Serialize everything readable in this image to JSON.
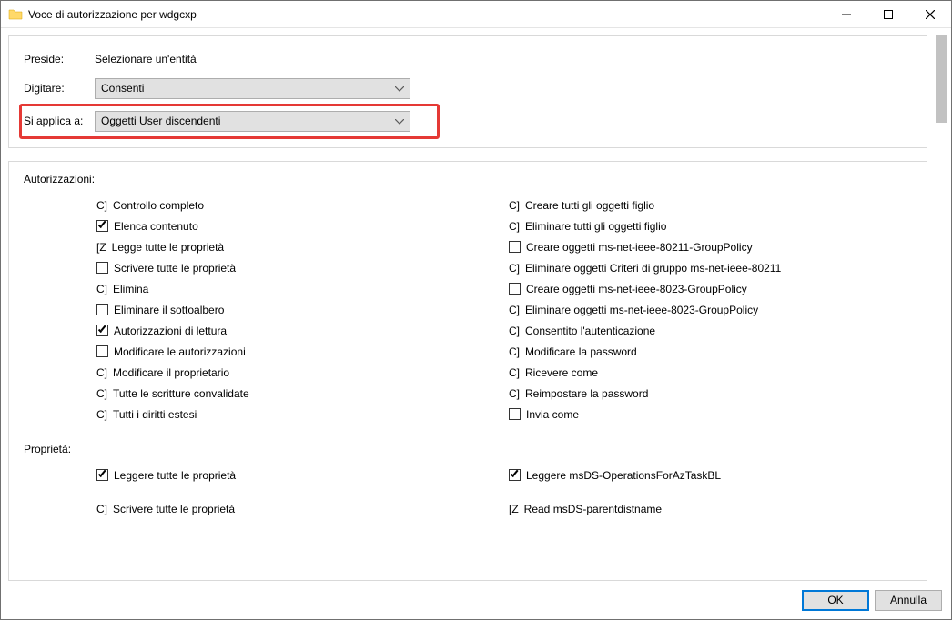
{
  "window": {
    "title": "Voce di autorizzazione per wdgcxp"
  },
  "top": {
    "principalLabel": "Preside:",
    "principalLink": "Selezionare un'entità",
    "typeLabel": "Digitare:",
    "typeValue": "Consenti",
    "appliesLabel": "Si applica a:",
    "appliesValue": "Oggetti User discendenti"
  },
  "permsLabel": "Autorizzazioni:",
  "propsLabel": "Proprietà:",
  "permsLeft": [
    {
      "prefix": "C]",
      "text": "Controllo completo",
      "state": "plain"
    },
    {
      "prefix": "box",
      "text": "Elenca contenuto",
      "state": "checked"
    },
    {
      "prefix": "[Z",
      "text": "Legge tutte le proprietà",
      "state": "plain"
    },
    {
      "prefix": "box",
      "text": "Scrivere tutte le proprietà",
      "state": "unchecked"
    },
    {
      "prefix": "C]",
      "text": "Elimina",
      "state": "plain"
    },
    {
      "prefix": "box",
      "text": "Eliminare il sottoalbero",
      "state": "unchecked"
    },
    {
      "prefix": "box",
      "text": "Autorizzazioni di lettura",
      "state": "checked"
    },
    {
      "prefix": "box",
      "text": "Modificare le autorizzazioni",
      "state": "unchecked"
    },
    {
      "prefix": "C]",
      "text": "Modificare il proprietario",
      "state": "plain"
    },
    {
      "prefix": "C]",
      "text": "Tutte le scritture convalidate",
      "state": "plain"
    },
    {
      "prefix": "C]",
      "text": "Tutti i diritti estesi",
      "state": "plain"
    }
  ],
  "permsRight": [
    {
      "prefix": "C]",
      "text": "Creare tutti gli oggetti figlio",
      "state": "plain"
    },
    {
      "prefix": "C]",
      "text": "Eliminare tutti gli oggetti figlio",
      "state": "plain"
    },
    {
      "prefix": "box",
      "text": "Creare oggetti ms-net-ieee-80211-GroupPolicy",
      "state": "unchecked"
    },
    {
      "prefix": "C]",
      "text": "Eliminare oggetti Criteri di gruppo ms-net-ieee-80211",
      "state": "plain"
    },
    {
      "prefix": "box",
      "text": "Creare oggetti ms-net-ieee-8023-GroupPolicy",
      "state": "unchecked"
    },
    {
      "prefix": "C]",
      "text": "Eliminare oggetti ms-net-ieee-8023-GroupPolicy",
      "state": "plain"
    },
    {
      "prefix": "C]",
      "text": "Consentito l'autenticazione",
      "state": "plain"
    },
    {
      "prefix": "C]",
      "text": "Modificare la password",
      "state": "plain"
    },
    {
      "prefix": "C]",
      "text": "Ricevere come",
      "state": "plain"
    },
    {
      "prefix": "C]",
      "text": "Reimpostare la password",
      "state": "plain"
    },
    {
      "prefix": "box",
      "text": "Invia come",
      "state": "unchecked"
    }
  ],
  "propsLeft": [
    {
      "prefix": "box",
      "text": "Leggere tutte le proprietà",
      "state": "checked"
    },
    {
      "prefix": "C]",
      "text": "Scrivere tutte le proprietà",
      "state": "plain"
    }
  ],
  "propsRight": [
    {
      "prefix": "box",
      "text": "Leggere msDS-OperationsForAzTaskBL",
      "state": "checked"
    },
    {
      "prefix": "[Z",
      "text": "Read msDS-parentdistname",
      "state": "plain"
    }
  ],
  "buttons": {
    "ok": "OK",
    "cancel": "Annulla"
  }
}
